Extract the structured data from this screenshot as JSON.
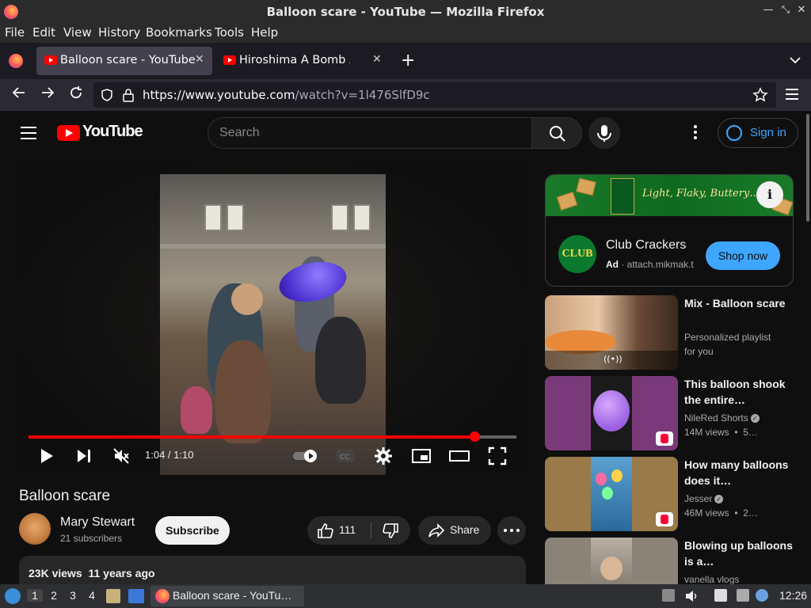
{
  "window": {
    "title": "Balloon scare - YouTube — Mozilla Firefox"
  },
  "menu": [
    "File",
    "Edit",
    "View",
    "History",
    "Bookmarks",
    "Tools",
    "Help"
  ],
  "tabs": [
    {
      "label": "Balloon scare - YouTube",
      "active": true
    },
    {
      "label": "Hiroshima A Bomb Attack",
      "active": false
    }
  ],
  "navbar": {
    "url_domain": "https://www.youtube.com",
    "url_path": "/watch?v=1l476SlfD9c"
  },
  "youtube": {
    "logo_text": "YouTube",
    "search_placeholder": "Search",
    "signin_label": "Sign in"
  },
  "player": {
    "time": "1:04 / 1:10",
    "progress_fraction": 0.914
  },
  "video": {
    "title": "Balloon scare",
    "channel": "Mary Stewart",
    "subscribers": "21 subscribers",
    "subscribe_label": "Subscribe",
    "likes": "111",
    "share_label": "Share",
    "views_age": "23K views  11 years ago"
  },
  "ad": {
    "banner_text": "Light, Flaky, Buttery…",
    "logo_text": "CLUB",
    "title": "Club Crackers",
    "badge": "Ad",
    "domain": "attach.mikmak.t",
    "cta": "Shop now"
  },
  "recommendations": [
    {
      "title": "Mix - Balloon scare",
      "line1": "Personalized playlist",
      "line2": "for you"
    },
    {
      "title": "This balloon shook the entire…",
      "channel": "NileRed Shorts",
      "stats": "14M views  •  5…"
    },
    {
      "title": "How many balloons does it…",
      "channel": "Jesser",
      "stats": "46M views  •  2…"
    },
    {
      "title": "Blowing up balloons is a…",
      "channel": "vanella vlogs"
    }
  ],
  "taskbar": {
    "workspaces": [
      "1",
      "2",
      "3",
      "4"
    ],
    "window_label": "Balloon scare - YouTu…",
    "clock": "12:26"
  },
  "colors": {
    "youtube_red": "#ff0000",
    "link_blue": "#3ea6ff",
    "page_bg": "#0f0f0f"
  }
}
